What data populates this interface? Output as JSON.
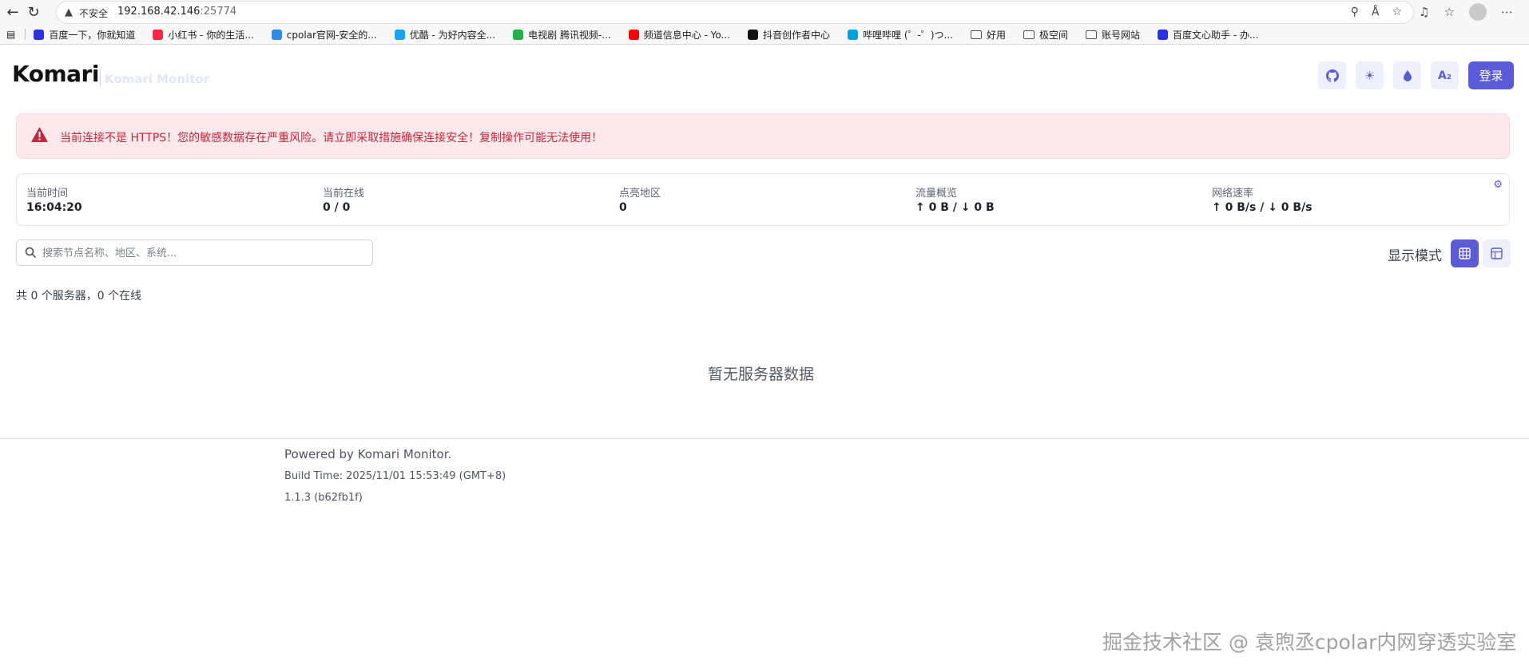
{
  "browser": {
    "insecure_label": "不安全",
    "url_host": "192.168.42.146",
    "url_port": ":25774"
  },
  "bookmarks": [
    {
      "label": "百度一下，你就知道",
      "icon": "baidu-paw-icon",
      "color": "#2932e1"
    },
    {
      "label": "小红书 - 你的生活...",
      "icon": "xiaohongshu-icon",
      "color": "#ff2442"
    },
    {
      "label": "cpolar官网-安全的...",
      "icon": "cpolar-icon",
      "color": "#2b8be6"
    },
    {
      "label": "优酷 - 为好内容全...",
      "icon": "youku-icon",
      "color": "#1ca0f2"
    },
    {
      "label": "电视剧 腾讯视频-...",
      "icon": "tencent-video-icon",
      "color": "#21b24b"
    },
    {
      "label": "频道信息中心 - Yo...",
      "icon": "youtube-icon",
      "color": "#ff0000"
    },
    {
      "label": "抖音创作者中心",
      "icon": "douyin-icon",
      "color": "#111111"
    },
    {
      "label": "哔哩哔哩 (゜-゜)つ...",
      "icon": "bilibili-icon",
      "color": "#00a1d6"
    },
    {
      "label": "好用",
      "icon": "folder-icon",
      "color": "#555555"
    },
    {
      "label": "极空间",
      "icon": "folder-icon",
      "color": "#555555"
    },
    {
      "label": "账号网站",
      "icon": "folder-icon",
      "color": "#555555"
    },
    {
      "label": "百度文心助手 - 办...",
      "icon": "baidu-paw-icon",
      "color": "#2932e1"
    }
  ],
  "header": {
    "logo": "Komari",
    "subtitle": "Komari Monitor",
    "login_label": "登录",
    "accent": "#5b5bd6"
  },
  "alert": {
    "text": "当前连接不是 HTTPS！您的敏感数据存在严重风险。请立即采取措施确保连接安全！复制操作可能无法使用！",
    "color": "#c0283c"
  },
  "stats": [
    {
      "label": "当前时间",
      "value": "16:04:20"
    },
    {
      "label": "当前在线",
      "value": "0 / 0"
    },
    {
      "label": "点亮地区",
      "value": "0"
    },
    {
      "label": "流量概览",
      "value": "↑ 0 B / ↓ 0 B"
    },
    {
      "label": "网络速率",
      "value": "↑ 0 B/s / ↓ 0 B/s"
    }
  ],
  "search": {
    "placeholder": "搜索节点名称、地区、系统..."
  },
  "display_mode_label": "显示模式",
  "server_count": "共 0 个服务器，0 个在线",
  "empty_text": "暂无服务器数据",
  "footer": {
    "powered": "Powered by Komari Monitor.",
    "build_time": "Build Time: 2025/11/01 15:53:49 (GMT+8)",
    "version": "1.1.3 (b62fb1f)"
  },
  "watermark": "掘金技术社区 @ 袁煦丞cpolar内网穿透实验室"
}
